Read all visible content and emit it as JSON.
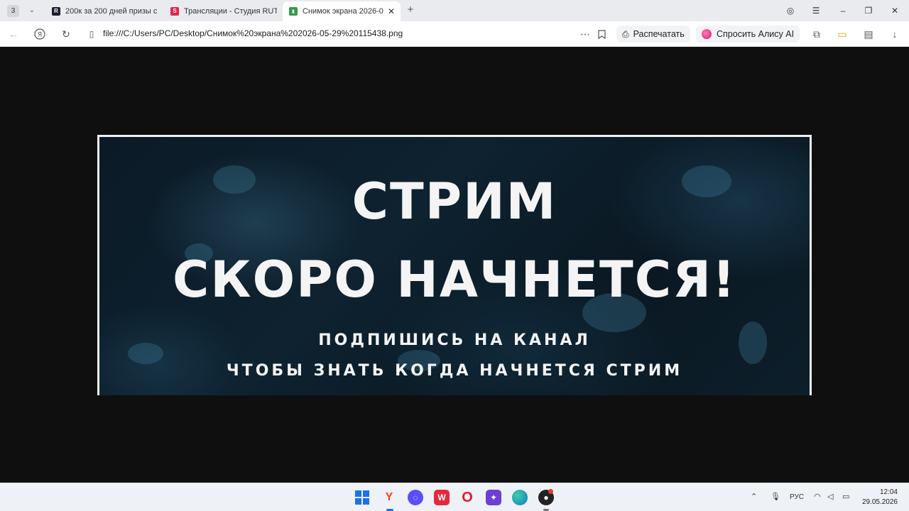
{
  "browser": {
    "tab_counter": "3",
    "tabs": [
      {
        "title": "200к за 200 дней призы с",
        "favicon": "R",
        "favicon_color": "#1d1d2b",
        "active": false
      },
      {
        "title": "Трансляции - Студия RUT",
        "favicon": "S",
        "favicon_color": "#e0264a",
        "active": false
      },
      {
        "title": "Снимок экрана 2026-0",
        "favicon": "▮",
        "favicon_color": "#2f9e44",
        "active": true
      }
    ],
    "address": "file:///C:/Users/PC/Desktop/Снимок%20экрана%202026-05-29%20115438.png",
    "print_label": "Распечатать",
    "alice_label": "Спросить Алису AI"
  },
  "banner": {
    "line1": "СТРИМ",
    "line2": "СКОРО НАЧНЕТСЯ!",
    "line3": "ПОДПИШИСЬ НА КАНАЛ",
    "line4": "ЧТОБЫ ЗНАТЬ КОГДА НАЧНЕТСЯ СТРИМ"
  },
  "taskbar": {
    "apps": [
      "windows-start",
      "yandex-browser",
      "messenger",
      "wps-office",
      "opera",
      "game",
      "edge",
      "obs"
    ],
    "language": "РУС",
    "time": "12:04",
    "date": "29.05.2026"
  },
  "colors": {
    "accent_yandex": "#fc3f1d",
    "viewer_bg": "#0f0f0f",
    "banner_text": "#f4f4f4"
  }
}
